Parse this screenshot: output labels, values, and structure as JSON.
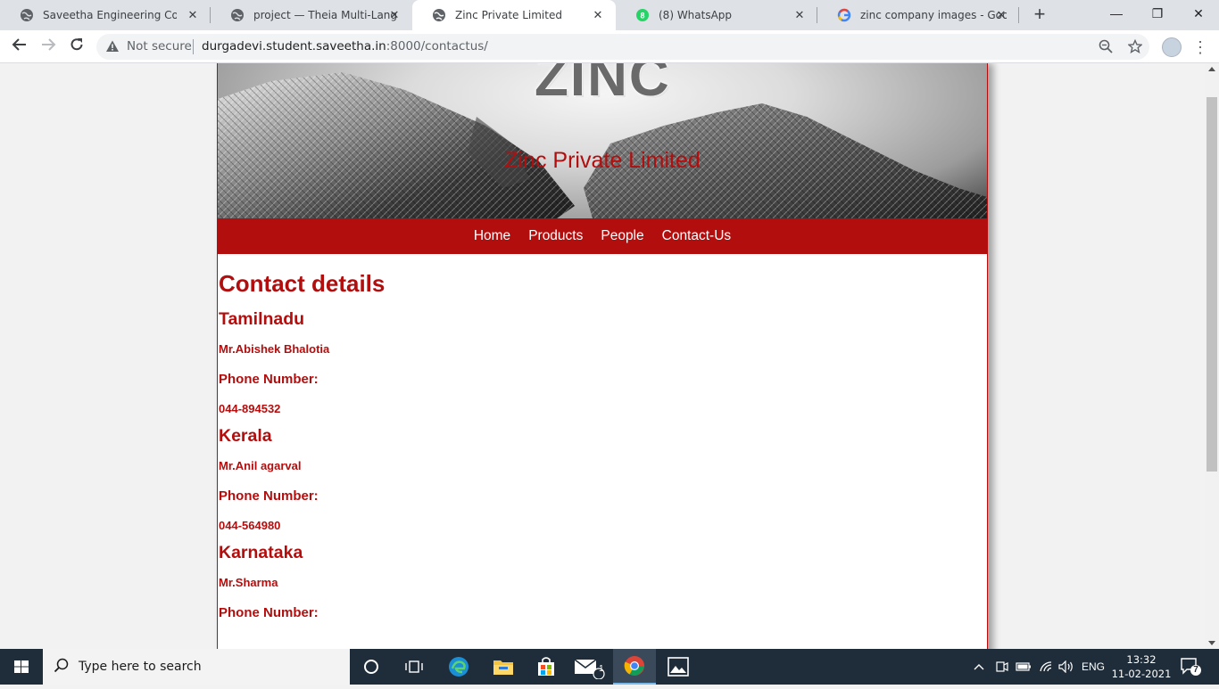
{
  "browser": {
    "tabs": [
      {
        "title": "Saveetha Engineering College",
        "icon": "globe-icon"
      },
      {
        "title": "project — Theia Multi-Languag",
        "icon": "globe-icon"
      },
      {
        "title": "Zinc Private Limited",
        "icon": "globe-icon",
        "active": true
      },
      {
        "title": "(8) WhatsApp",
        "icon": "whatsapp-icon"
      },
      {
        "title": "zinc company images - Google",
        "icon": "google-icon"
      }
    ],
    "new_tab_label": "+",
    "window_controls": {
      "minimize": "—",
      "restore": "❐",
      "close": "✕"
    },
    "security_label": "Not secure",
    "url_host": "durgadevi.student.saveetha.in",
    "url_path": ":8000/contactus/"
  },
  "site": {
    "banner_logo": "ZINC",
    "banner_subtitle": "Zinc Private Limited",
    "nav": [
      "Home",
      "Products",
      "People",
      "Contact-Us"
    ],
    "heading": "Contact details",
    "contacts": [
      {
        "state": "Tamilnadu",
        "name": "Mr.Abishek Bhalotia",
        "phone_label": "Phone Number:",
        "phone": "044-894532"
      },
      {
        "state": "Kerala",
        "name": "Mr.Anil agarval",
        "phone_label": "Phone Number:",
        "phone": "044-564980"
      },
      {
        "state": "Karnataka",
        "name": "Mr.Sharma",
        "phone_label": "Phone Number:"
      }
    ],
    "accent_color": "#b30e0e"
  },
  "taskbar": {
    "search_placeholder": "Type here to search",
    "mail_badge": "1",
    "language": "ENG",
    "time": "13:32",
    "date": "11-02-2021",
    "notification_count": "7"
  }
}
